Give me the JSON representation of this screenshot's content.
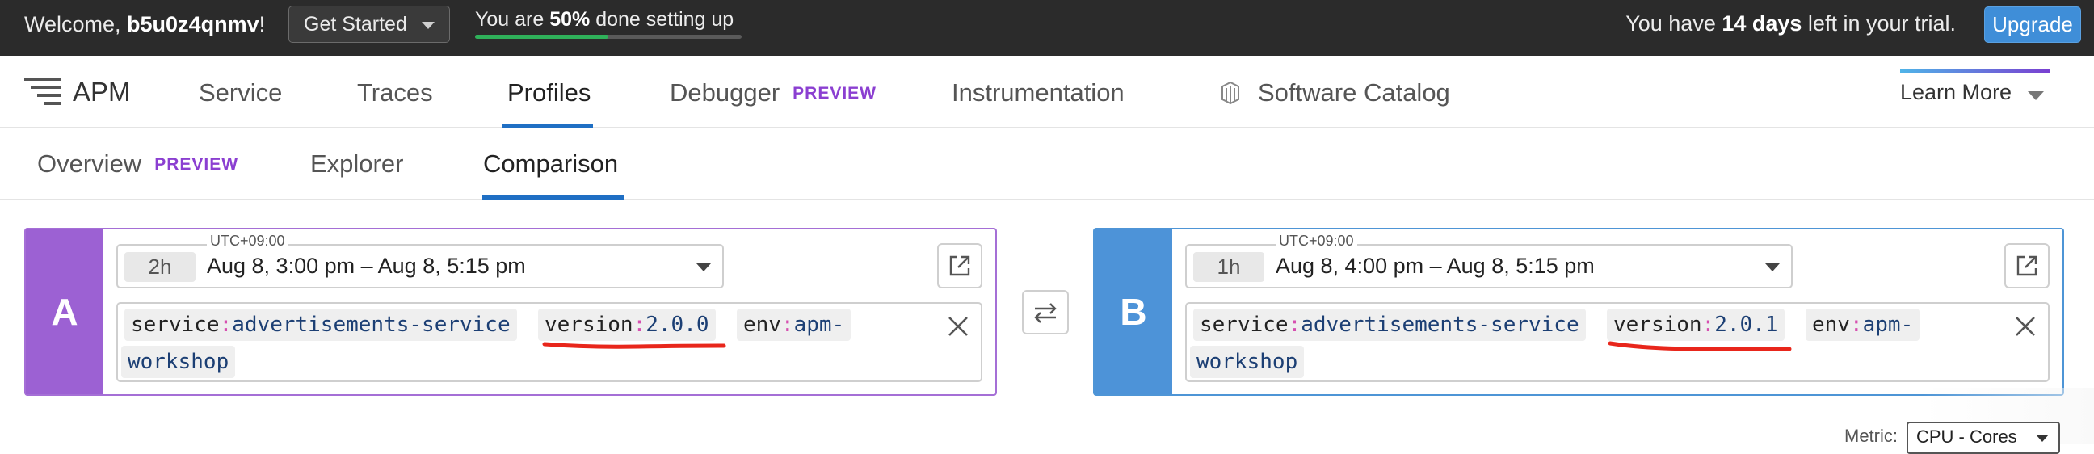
{
  "banner": {
    "welcome_prefix": "Welcome, ",
    "username": "b5u0z4qnmv",
    "welcome_suffix": "!",
    "get_started_label": "Get Started",
    "setup_prefix": "You are ",
    "setup_percent_text": "50%",
    "setup_suffix": " done setting up",
    "setup_progress": 0.5,
    "trial_prefix": "You have ",
    "trial_days": "14 days",
    "trial_suffix": " left in your trial.",
    "upgrade_label": "Upgrade"
  },
  "nav": {
    "app_name": "APM",
    "items": [
      {
        "label": "Service"
      },
      {
        "label": "Traces"
      },
      {
        "label": "Profiles"
      },
      {
        "label": "Debugger",
        "badge": "PREVIEW"
      },
      {
        "label": "Instrumentation"
      },
      {
        "label": "Software Catalog"
      }
    ],
    "learn_more_label": "Learn More"
  },
  "subnav": {
    "items": [
      {
        "label": "Overview",
        "badge": "PREVIEW"
      },
      {
        "label": "Explorer"
      },
      {
        "label": "Comparison"
      }
    ]
  },
  "comparison": {
    "a": {
      "letter": "A",
      "timezone": "UTC+09:00",
      "duration": "2h",
      "range": "Aug 8, 3:00 pm – Aug 8, 5:15 pm",
      "tags": [
        {
          "key": "service",
          "value": "advertisements-service"
        },
        {
          "key": "version",
          "value": "2.0.0"
        },
        {
          "key": "env",
          "value": "apm-"
        },
        {
          "key": "",
          "value": "workshop"
        }
      ]
    },
    "b": {
      "letter": "B",
      "timezone": "UTC+09:00",
      "duration": "1h",
      "range": "Aug 8, 4:00 pm – Aug 8, 5:15 pm",
      "tags": [
        {
          "key": "service",
          "value": "advertisements-service"
        },
        {
          "key": "version",
          "value": "2.0.1"
        },
        {
          "key": "env",
          "value": "apm-"
        },
        {
          "key": "",
          "value": "workshop"
        }
      ]
    },
    "colon": ":"
  },
  "metric": {
    "label": "Metric:",
    "selected": "CPU - Cores"
  },
  "colors": {
    "accent_blue": "#1f6fc4",
    "panel_a": "#9c61d3",
    "panel_b": "#4d93d8",
    "annotation_red": "#e8261b"
  }
}
